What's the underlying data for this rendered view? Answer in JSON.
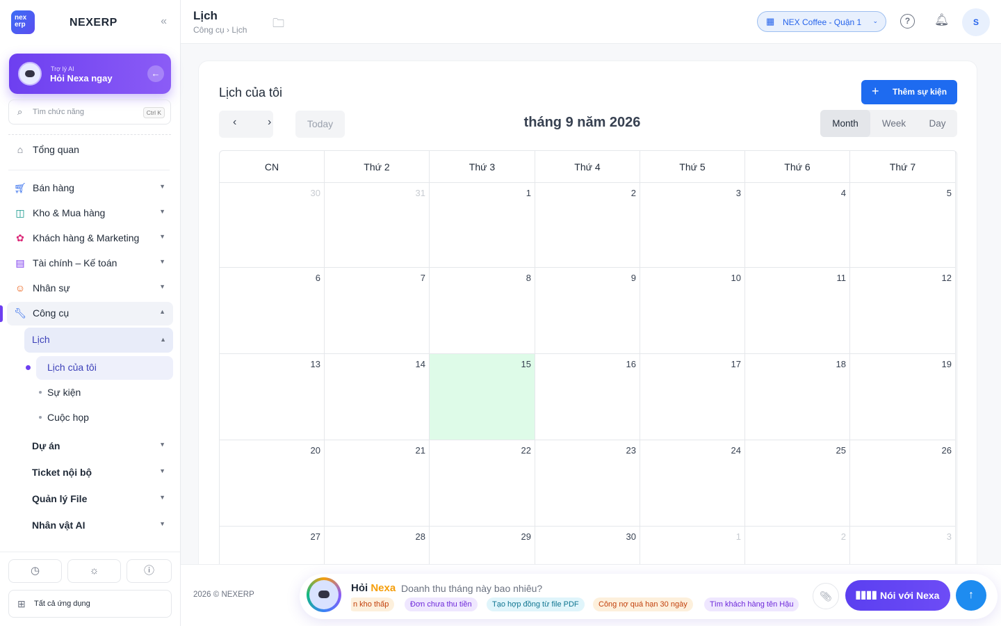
{
  "brand": {
    "logo_text": "nex erp",
    "name": "NEXERP"
  },
  "ai_card": {
    "small": "Trợ lý AI",
    "big": "Hỏi Nexa ngay"
  },
  "search": {
    "placeholder": "Tìm chức năng",
    "shortcut": "Ctrl K"
  },
  "sidebar": {
    "overview": "Tổng quan",
    "groups": [
      {
        "label": "Bán hàng",
        "icon": "cart-icon"
      },
      {
        "label": "Kho & Mua hàng",
        "icon": "bag-icon"
      },
      {
        "label": "Khách hàng & Marketing",
        "icon": "people-icon"
      },
      {
        "label": "Tài chính – Kế toán",
        "icon": "calculator-icon"
      },
      {
        "label": "Nhân sự",
        "icon": "person-icon"
      },
      {
        "label": "Công cụ",
        "icon": "wrench-icon"
      }
    ],
    "tools": {
      "lich": "Lịch",
      "lich_items": [
        "Lịch của tôi",
        "Sự kiện",
        "Cuộc họp"
      ],
      "others": [
        "Dự án",
        "Ticket nội bộ",
        "Quản lý File",
        "Nhân vật AI"
      ]
    },
    "all_apps": "Tất cả ứng dụng"
  },
  "topbar": {
    "title": "Lịch",
    "breadcrumb": "Công cụ › Lịch",
    "branch": "NEX Coffee - Quận 1",
    "avatar": "S"
  },
  "calendar": {
    "title": "Lịch của tôi",
    "add_label": "Thêm sự kiện",
    "today_label": "Today",
    "month_title": "tháng 9 năm 2026",
    "views": [
      "Month",
      "Week",
      "Day"
    ],
    "active_view": "Month",
    "weekdays": [
      "CN",
      "Thứ 2",
      "Thứ 3",
      "Thứ 4",
      "Thứ 5",
      "Thứ 6",
      "Thứ 7"
    ],
    "weeks": [
      [
        {
          "d": "30",
          "out": true
        },
        {
          "d": "31",
          "out": true
        },
        {
          "d": "1"
        },
        {
          "d": "2"
        },
        {
          "d": "3"
        },
        {
          "d": "4"
        },
        {
          "d": "5"
        }
      ],
      [
        {
          "d": "6"
        },
        {
          "d": "7"
        },
        {
          "d": "8"
        },
        {
          "d": "9"
        },
        {
          "d": "10"
        },
        {
          "d": "11"
        },
        {
          "d": "12"
        }
      ],
      [
        {
          "d": "13"
        },
        {
          "d": "14"
        },
        {
          "d": "15",
          "today": true
        },
        {
          "d": "16"
        },
        {
          "d": "17"
        },
        {
          "d": "18"
        },
        {
          "d": "19"
        }
      ],
      [
        {
          "d": "20"
        },
        {
          "d": "21"
        },
        {
          "d": "22"
        },
        {
          "d": "23"
        },
        {
          "d": "24"
        },
        {
          "d": "25"
        },
        {
          "d": "26"
        }
      ],
      [
        {
          "d": "27"
        },
        {
          "d": "28"
        },
        {
          "d": "29"
        },
        {
          "d": "30"
        },
        {
          "d": "1",
          "out": true
        },
        {
          "d": "2",
          "out": true
        },
        {
          "d": "3",
          "out": true
        }
      ]
    ]
  },
  "footer": {
    "copyright": "2026 © NEXERP",
    "ask_prefix": "Hỏi",
    "ask_brand": "Nexa",
    "question": "Doanh thu tháng này bao nhiêu?",
    "chips": [
      {
        "text": "n kho thấp",
        "bg": "#fdf0dc",
        "fg": "#c2410c"
      },
      {
        "text": "Đơn chưa thu tiền",
        "bg": "#efe7ff",
        "fg": "#6d28d9"
      },
      {
        "text": "Tạo hợp đồng từ file PDF",
        "bg": "#e0f5fb",
        "fg": "#0e7490"
      },
      {
        "text": "Công nợ quá hạn 30 ngày",
        "bg": "#fdf0dc",
        "fg": "#c2410c"
      },
      {
        "text": "Tìm khách hàng tên Hậu",
        "bg": "#efe7ff",
        "fg": "#6d28d9"
      }
    ],
    "talk_label": "Nói với Nexa"
  }
}
